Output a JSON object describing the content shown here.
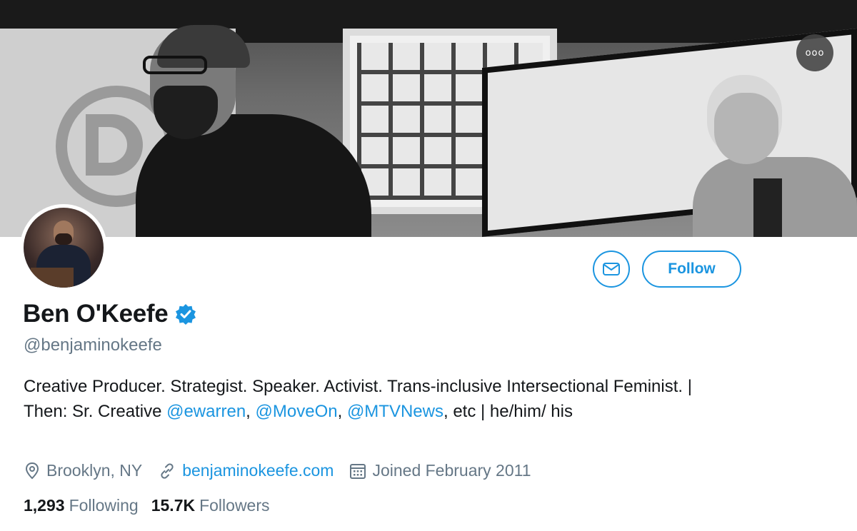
{
  "header": {
    "more_icon": "more-horizontal-icon",
    "more_label": "ooo"
  },
  "profile": {
    "display_name": "Ben O'Keefe",
    "verified_icon": "verified-badge-icon",
    "handle": "@benjaminokeefe",
    "bio": {
      "part1": "Creative Producer. Strategist. Speaker. Activist. Trans-inclusive Intersectional Feminist. | Then: Sr. Creative ",
      "mention1": "@ewarren",
      "sep1": ", ",
      "mention2": "@MoveOn",
      "sep2": ", ",
      "mention3": "@MTVNews",
      "part2": ", etc | he/him/ his"
    },
    "location": "Brooklyn, NY",
    "website": "benjaminokeefe.com",
    "joined": "Joined February 2011"
  },
  "actions": {
    "message_icon": "envelope-icon",
    "follow_label": "Follow"
  },
  "stats": {
    "following_count": "1,293",
    "following_label": "Following",
    "followers_count": "15.7K",
    "followers_label": "Followers"
  },
  "colors": {
    "accent": "#1b95e0",
    "secondary_text": "#657786",
    "primary_text": "#14171a"
  }
}
